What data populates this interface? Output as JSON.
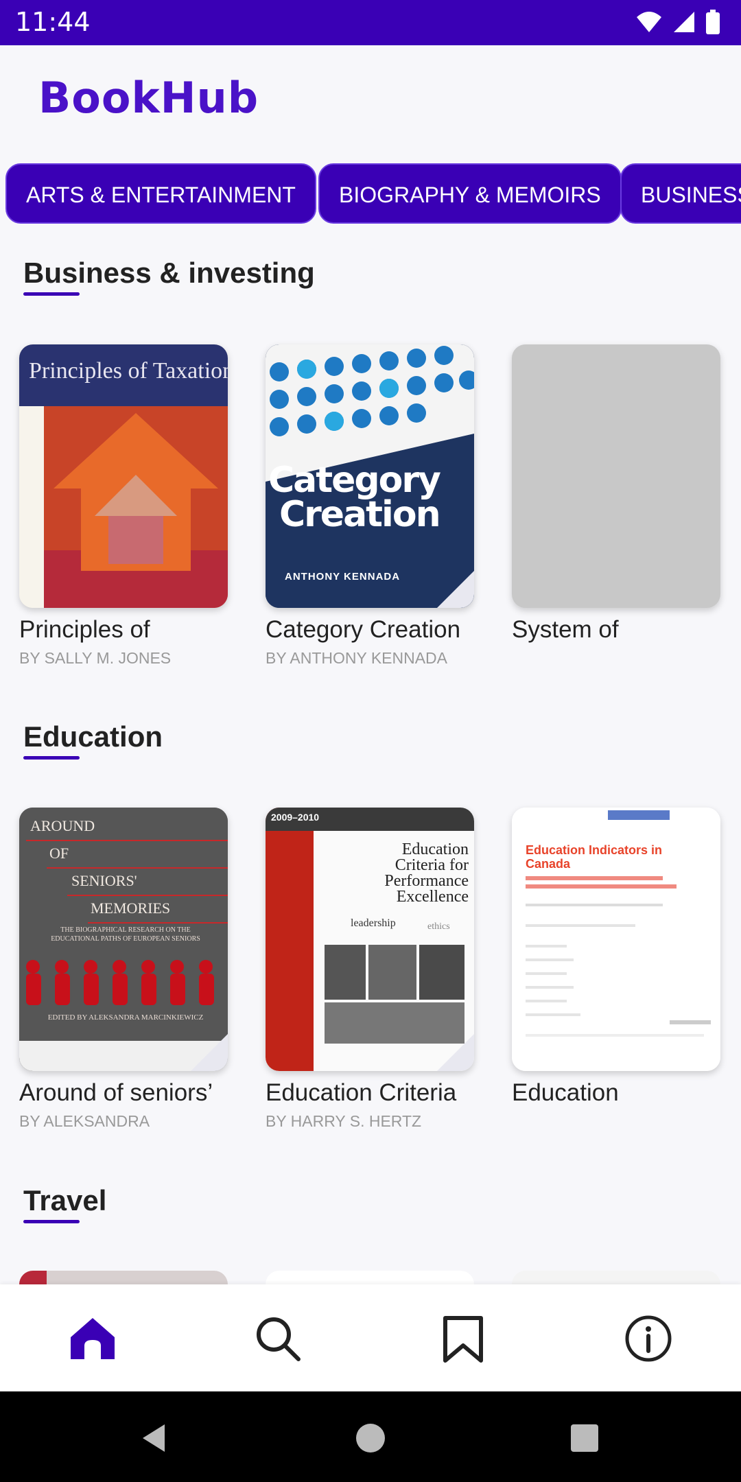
{
  "status_bar": {
    "time": "11:44",
    "background": "#3a00b5"
  },
  "app": {
    "title": "BookHub",
    "accent": "#3a00b5"
  },
  "categories": [
    "ARTS & ENTERTAINMENT",
    "BIOGRAPHY & MEMOIRS",
    "BUSINESS"
  ],
  "sections": [
    {
      "title": "Business & investing",
      "books": [
        {
          "title": "Principles of",
          "author": "BY SALLY M. JONES",
          "cover": "principles-of-taxation-cover"
        },
        {
          "title": "Category Creation",
          "author": "BY ANTHONY KENNADA",
          "cover": "category-creation-cover"
        },
        {
          "title": "System of",
          "author": "",
          "cover": "placeholder-cover"
        }
      ]
    },
    {
      "title": "Education",
      "books": [
        {
          "title": "Around of seniors’",
          "author": "BY ALEKSANDRA",
          "cover": "around-of-seniors-cover"
        },
        {
          "title": "Education Criteria",
          "author": "BY HARRY S. HERTZ",
          "cover": "education-criteria-cover"
        },
        {
          "title": "Education",
          "author": "",
          "cover": "education-indicators-cover"
        }
      ]
    },
    {
      "title": "Travel",
      "books": []
    }
  ],
  "covers": {
    "principles": {
      "title_text": "Principles of Taxation"
    },
    "category": {
      "word1": "Category",
      "word2": "Creation",
      "author": "ANTHONY KENNADA"
    },
    "around": {
      "l1": "AROUND",
      "l2": "OF",
      "l3": "SENIORS'",
      "l4": "MEMORIES",
      "sub": "THE BIOGRAPHICAL RESEARCH ON THE EDUCATIONAL PATHS OF EUROPEAN SENIORS",
      "edited": "EDITED BY ALEKSANDRA MARCINKIEWICZ"
    },
    "criteria": {
      "year": "2009–2010",
      "text": "Education Criteria for Performance Excellence",
      "leadership": "leadership",
      "ethics": "ethics"
    },
    "indicators": {
      "title": "Education Indicators in Canada"
    }
  },
  "bottom_nav": [
    {
      "name": "home",
      "icon": "home-icon",
      "active": true
    },
    {
      "name": "search",
      "icon": "search-icon",
      "active": false
    },
    {
      "name": "bookmarks",
      "icon": "bookmark-icon",
      "active": false
    },
    {
      "name": "info",
      "icon": "info-icon",
      "active": false
    }
  ]
}
